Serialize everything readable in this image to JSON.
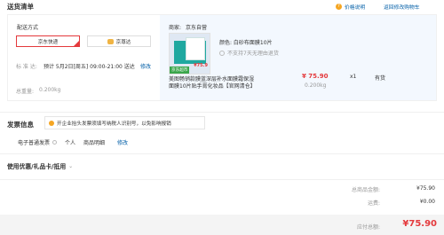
{
  "header": {
    "title": "送货清单",
    "price_link": "价格说明",
    "back_link": "返回修改购物车"
  },
  "shipping": {
    "method_label": "配送方式",
    "option1": "京东快递",
    "option2": "京尊达",
    "time_label": "标 准 达:",
    "time_value": "预计 5月2日[周五] 09:00-21:00 送达",
    "modify": "修改",
    "weight_label": "总重量:",
    "weight_value": "0.200kg"
  },
  "item": {
    "seller_label": "商家:",
    "seller": "京东自营",
    "color": "颜色: 白砂布面膜10片",
    "no_return": "不支持7天无理由退货",
    "jd_badge": "京东超市",
    "name_line1": "美图畅销款膜蓝深层补水面膜霜保湿",
    "name_line2": "面膜10片贴手膏化妆品【官网清仓】",
    "price": "¥ 75.90",
    "weight": "0.200kg",
    "qty": "x1",
    "stock": "有货",
    "thumb_price": "¥75.9"
  },
  "invoice": {
    "title": "发票信息",
    "tip": "开企业抬头发票须填写纳税人识别号，以免影响报销",
    "type": "电子普通发票",
    "person": "个人",
    "detail": "商品明细",
    "modify": "修改"
  },
  "coupon": {
    "title": "使用优惠/礼品卡/抵用"
  },
  "summary": {
    "total_label": "总商品金额:",
    "total_value": "¥75.90",
    "freight_label": "运费:",
    "freight_value": "¥0.00",
    "payable_label": "应付总额:",
    "payable_value": "¥75.90"
  },
  "colors": {
    "accent": "#e4393c",
    "link": "#005ea7",
    "pane_bg": "#f3f8fe"
  }
}
